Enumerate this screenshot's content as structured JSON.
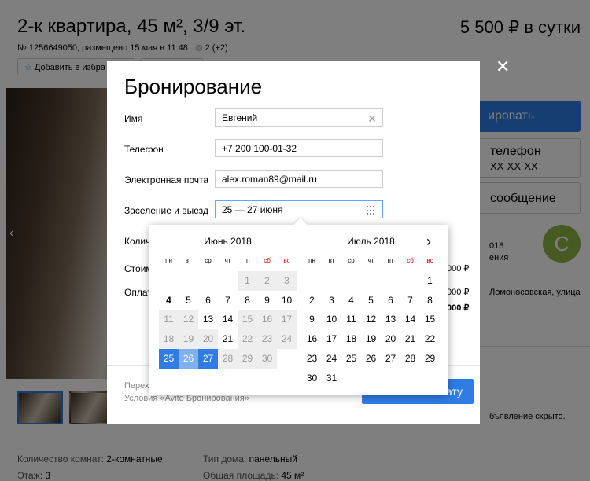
{
  "listing": {
    "title": "2-к квартира, 45 м², 3/9 эт.",
    "price": "5 500 ₽ в сутки",
    "meta": "№ 1256649050, размещено 15 мая в 11:48",
    "views": "2 (+2)",
    "favorite_label": "Добавить в избра",
    "params": {
      "rooms_label": "Количество комнат:",
      "rooms_value": "2-комнатные",
      "house_label": "Тип дома:",
      "house_value": "панельный",
      "floor_label": "Этаж:",
      "floor_value": "3",
      "area_label": "Общая площадь:",
      "area_value": "45 м²"
    }
  },
  "sidebar": {
    "book_button_partial": "ировать",
    "phone_line1": "телефон",
    "phone_line2": "XX-XX-XX",
    "message_partial": "сообщение",
    "seller_year": "018",
    "seller_note": "ения",
    "avatar_letter": "C",
    "address_partial": "Ломоносовская, улица",
    "hidden_note": "бъявление скрыто."
  },
  "modal": {
    "title": "Бронирование",
    "name_label": "Имя",
    "name_value": "Евгений",
    "phone_label": "Телефон",
    "phone_value": "+7 200 100-01-32",
    "email_label": "Электронная почта",
    "email_value": "alex.roman89@mail.ru",
    "dates_label": "Заселение и выезд",
    "dates_value": "25 — 27 июня",
    "guests_label_partial": "Количе",
    "cost_label_partial": "Стоим",
    "pay_label_partial": "Оплат",
    "cost_value_partial": "000 ₽",
    "total1_partial": "000 ₽",
    "total2_partial": "000 ₽",
    "footer_text": "Перех",
    "terms_link": "Условия «Avito Бронирования»",
    "pay_button_partial": "плату"
  },
  "calendar": {
    "weekdays": [
      "пн",
      "вт",
      "ср",
      "чт",
      "пт",
      "сб",
      "вс"
    ],
    "months": [
      {
        "title": "Июнь 2018",
        "cells": [
          {
            "d": ""
          },
          {
            "d": ""
          },
          {
            "d": ""
          },
          {
            "d": ""
          },
          {
            "d": "1",
            "s": "past"
          },
          {
            "d": "2",
            "s": "past"
          },
          {
            "d": "3",
            "s": "past"
          },
          {
            "d": "4",
            "s": "bold"
          },
          {
            "d": "5"
          },
          {
            "d": "6"
          },
          {
            "d": "7"
          },
          {
            "d": "8"
          },
          {
            "d": "9"
          },
          {
            "d": "10"
          },
          {
            "d": "11",
            "s": "past"
          },
          {
            "d": "12",
            "s": "past"
          },
          {
            "d": "13"
          },
          {
            "d": "14"
          },
          {
            "d": "15",
            "s": "past"
          },
          {
            "d": "16",
            "s": "past"
          },
          {
            "d": "17",
            "s": "past"
          },
          {
            "d": "18",
            "s": "past"
          },
          {
            "d": "19",
            "s": "past"
          },
          {
            "d": "20",
            "s": "past"
          },
          {
            "d": "21"
          },
          {
            "d": "22",
            "s": "past"
          },
          {
            "d": "23",
            "s": "past"
          },
          {
            "d": "24",
            "s": "past"
          },
          {
            "d": "25",
            "s": "sel-edge"
          },
          {
            "d": "26",
            "s": "sel-mid"
          },
          {
            "d": "27",
            "s": "sel-edge"
          },
          {
            "d": "28",
            "s": "past"
          },
          {
            "d": "29",
            "s": "past"
          },
          {
            "d": "30",
            "s": "past"
          },
          {
            "d": ""
          }
        ]
      },
      {
        "title": "Июль 2018",
        "cells": [
          {
            "d": ""
          },
          {
            "d": ""
          },
          {
            "d": ""
          },
          {
            "d": ""
          },
          {
            "d": ""
          },
          {
            "d": ""
          },
          {
            "d": "1"
          },
          {
            "d": "2"
          },
          {
            "d": "3"
          },
          {
            "d": "4"
          },
          {
            "d": "5"
          },
          {
            "d": "6"
          },
          {
            "d": "7"
          },
          {
            "d": "8"
          },
          {
            "d": "9"
          },
          {
            "d": "10"
          },
          {
            "d": "11"
          },
          {
            "d": "12"
          },
          {
            "d": "13"
          },
          {
            "d": "14"
          },
          {
            "d": "15"
          },
          {
            "d": "16"
          },
          {
            "d": "17"
          },
          {
            "d": "18"
          },
          {
            "d": "19"
          },
          {
            "d": "20"
          },
          {
            "d": "21"
          },
          {
            "d": "22"
          },
          {
            "d": "23"
          },
          {
            "d": "24"
          },
          {
            "d": "25"
          },
          {
            "d": "26"
          },
          {
            "d": "27"
          },
          {
            "d": "28"
          },
          {
            "d": "29"
          },
          {
            "d": "30"
          },
          {
            "d": "31"
          },
          {
            "d": ""
          },
          {
            "d": ""
          },
          {
            "d": ""
          },
          {
            "d": ""
          },
          {
            "d": ""
          }
        ]
      }
    ]
  },
  "colors": {
    "accent": "#2f7ce5",
    "range_middle": "#7fb1f2",
    "weekend": "#cc0000",
    "overlay": "rgba(0,0,0,0.5)"
  }
}
